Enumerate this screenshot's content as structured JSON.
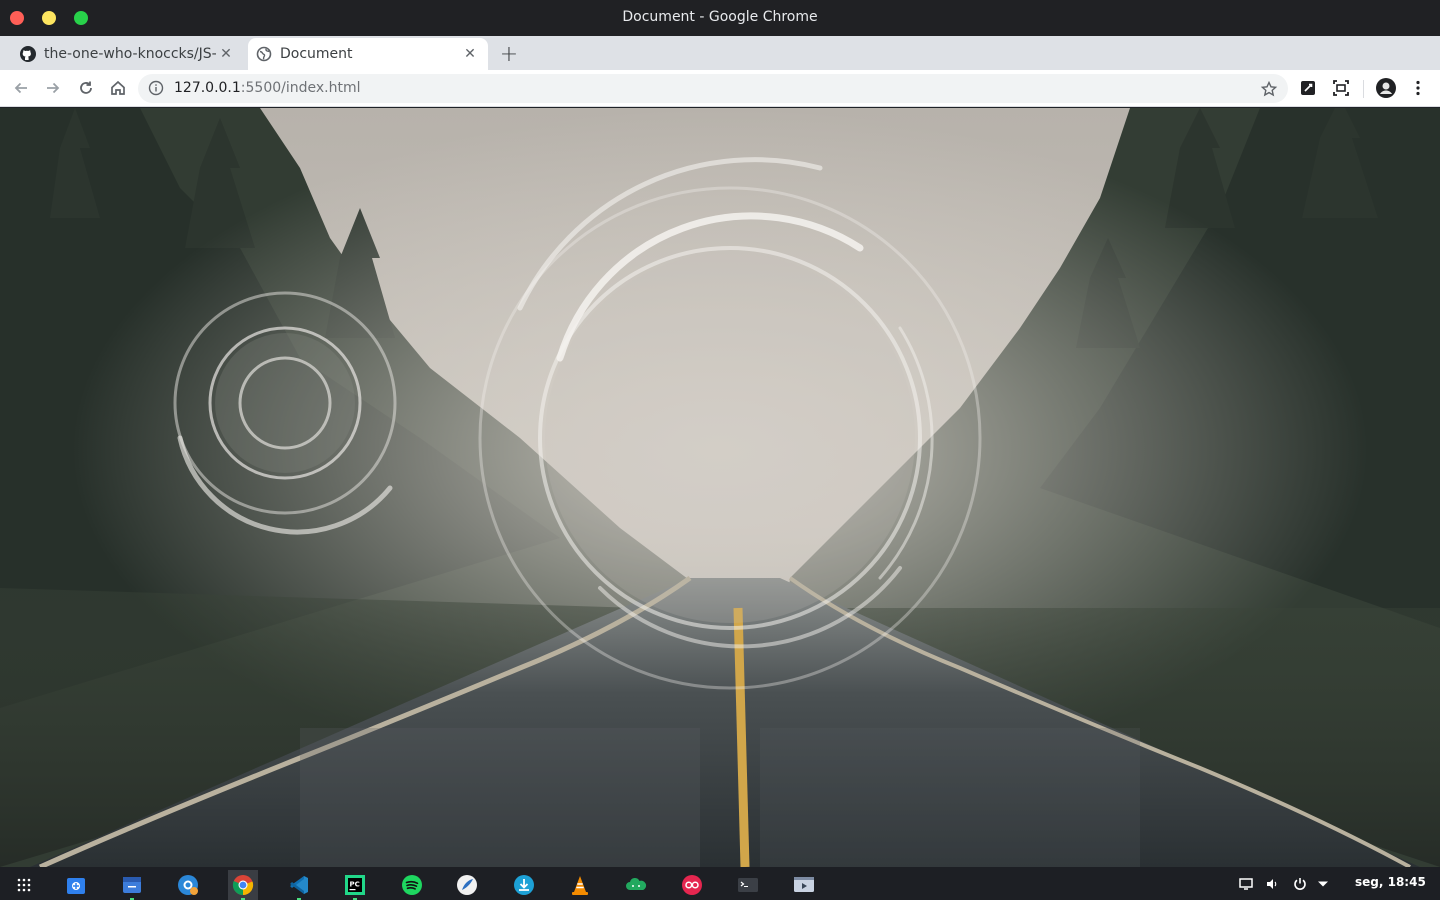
{
  "window": {
    "title": "Document - Google Chrome"
  },
  "tabs": [
    {
      "label": "the-one-who-knoccks/JS-",
      "icon": "github-icon",
      "active": false
    },
    {
      "label": "Document",
      "icon": "globe-icon",
      "active": true
    }
  ],
  "toolbar": {
    "url_host": "127.0.0.1",
    "url_rest": ":5500/index.html"
  },
  "page": {
    "image_description_icon": "forest-road-ripple-background"
  },
  "taskbar": {
    "apps": [
      "app-grid-icon",
      "software-center-icon",
      "files-icon",
      "settings-icon",
      "chrome-icon",
      "vscode-icon",
      "pycharm-icon",
      "spotify-icon",
      "feather-icon",
      "downloader-icon",
      "vlc-icon",
      "cloud-icon",
      "flickr-icon",
      "terminal-icon",
      "video-icon"
    ],
    "clock": "seg, 18:45"
  },
  "colors": {
    "titlebar": "#202124",
    "tabstrip": "#dee1e6",
    "taskbar": "#1d1f24",
    "accent_green": "#4ade80"
  }
}
